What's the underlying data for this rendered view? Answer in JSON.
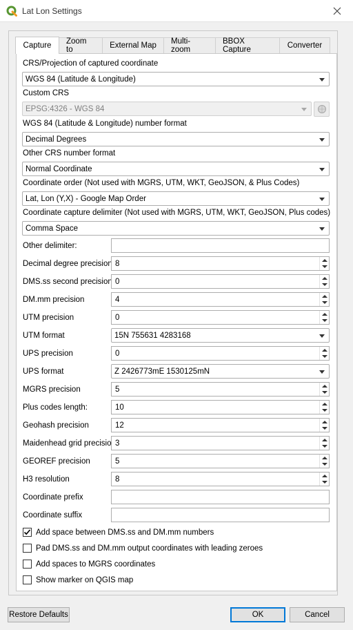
{
  "window": {
    "title": "Lat Lon Settings"
  },
  "tabs": [
    "Capture",
    "Zoom to",
    "External Map",
    "Multi-zoom",
    "BBOX Capture",
    "Converter"
  ],
  "capture": {
    "crs_label": "CRS/Projection of captured coordinate",
    "crs_value": "WGS 84 (Latitude & Longitude)",
    "custom_crs_label": "Custom CRS",
    "custom_crs_value": "EPSG:4326 - WGS 84",
    "wgs84_format_label": "WGS 84 (Latitude & Longitude) number format",
    "wgs84_format_value": "Decimal Degrees",
    "other_crs_label": "Other CRS number format",
    "other_crs_value": "Normal Coordinate",
    "coord_order_label": "Coordinate order (Not used with MGRS, UTM, WKT, GeoJSON, & Plus Codes)",
    "coord_order_value": "Lat, Lon (Y,X) - Google Map Order",
    "delimiter_label": "Coordinate capture delimiter (Not used with MGRS, UTM, WKT, GeoJSON, Plus codes)",
    "delimiter_value": "Comma Space"
  },
  "form_rows": [
    {
      "label": "Other delimiter:",
      "value": ""
    },
    {
      "label": "Decimal degree precision",
      "value": "8"
    },
    {
      "label": "DMS.ss second precision:",
      "value": "0"
    },
    {
      "label": "DM.mm precision",
      "value": "4"
    },
    {
      "label": "UTM precision",
      "value": "0"
    },
    {
      "label": "UTM format",
      "value": "15N 755631 4283168"
    },
    {
      "label": "UPS precision",
      "value": "0"
    },
    {
      "label": "UPS format",
      "value": "Z 2426773mE 1530125mN"
    },
    {
      "label": "MGRS precision",
      "value": "5"
    },
    {
      "label": "Plus codes length:",
      "value": "10"
    },
    {
      "label": "Geohash precision",
      "value": "12"
    },
    {
      "label": "Maidenhead grid precision",
      "value": "3"
    },
    {
      "label": "GEOREF precision",
      "value": "5"
    },
    {
      "label": "H3 resolution",
      "value": "8"
    },
    {
      "label": "Coordinate prefix",
      "value": ""
    },
    {
      "label": "Coordinate suffix",
      "value": ""
    }
  ],
  "checkboxes": [
    {
      "label": "Add space between DMS.ss and DM.mm numbers",
      "checked": true
    },
    {
      "label": "Pad DMS.ss and DM.mm output coordinates with leading zeroes",
      "checked": false
    },
    {
      "label": "Add spaces to MGRS coordinates",
      "checked": false
    },
    {
      "label": "Show marker on QGIS map",
      "checked": false
    }
  ],
  "buttons": {
    "restore": "Restore Defaults",
    "ok": "OK",
    "cancel": "Cancel"
  },
  "colors": {
    "accent": "#0078d7",
    "qgis_green": "#589632",
    "qgis_yellow": "#ee9b1e"
  },
  "icons": {
    "app": "qgis-logo-icon",
    "close": "close-icon",
    "crs_select": "globe-icon"
  }
}
